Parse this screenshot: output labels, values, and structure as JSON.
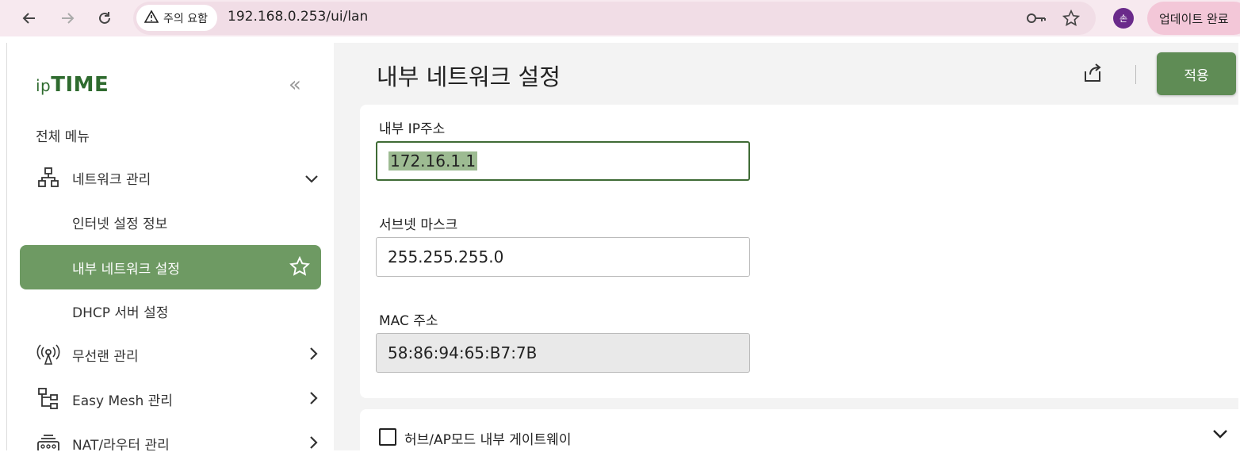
{
  "browser": {
    "security_label": "주의 요함",
    "url": "192.168.0.253/ui/lan",
    "profile_initial": "손",
    "update_label": "업데이트 완료"
  },
  "sidebar": {
    "logo_prefix": "ip",
    "logo_main": "TIME",
    "menu_header": "전체 메뉴",
    "network_mgmt": "네트워크 관리",
    "sub_items": [
      "인터넷 설정 정보",
      "내부 네트워크 설정",
      "DHCP 서버 설정"
    ],
    "wireless_mgmt": "무선랜 관리",
    "easymesh_mgmt": "Easy Mesh 관리",
    "nat_mgmt": "NAT/라우터 관리"
  },
  "main": {
    "title": "내부 네트워크 설정",
    "apply_label": "적용",
    "fields": [
      {
        "label": "내부 IP주소",
        "value": "172.16.1.1"
      },
      {
        "label": "서브넷 마스크",
        "value": "255.255.255.0"
      },
      {
        "label": "MAC 주소",
        "value": "58:86:94:65:B7:7B"
      }
    ],
    "hub_ap_label": "허브/AP모드 내부 게이트웨이"
  },
  "colors": {
    "accent": "#6e9a63",
    "apply": "#5f8c55",
    "selection": "#9dbb92"
  }
}
